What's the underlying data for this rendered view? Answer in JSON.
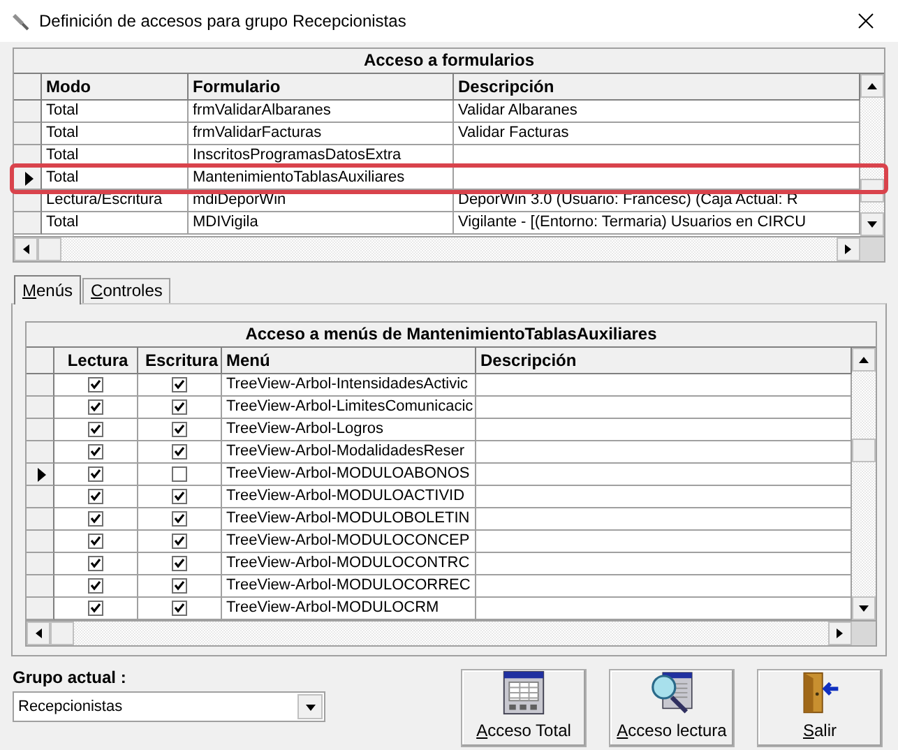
{
  "window": {
    "title": "Definición de accesos para grupo Recepcionistas"
  },
  "forms_grid": {
    "caption": "Acceso a formularios",
    "columns": [
      "Modo",
      "Formulario",
      "Descripción"
    ],
    "rows": [
      {
        "cells": [
          "Total",
          "frmValidarAlbaranes",
          "Validar Albaranes"
        ],
        "selected": false,
        "highlighted": false
      },
      {
        "cells": [
          "Total",
          "frmValidarFacturas",
          "Validar Facturas"
        ],
        "selected": false,
        "highlighted": false
      },
      {
        "cells": [
          "Total",
          "InscritosProgramasDatosExtra",
          ""
        ],
        "selected": false,
        "highlighted": false
      },
      {
        "cells": [
          "Total",
          "MantenimientoTablasAuxiliares",
          ""
        ],
        "selected": true,
        "highlighted": true
      },
      {
        "cells": [
          "Lectura/Escritura",
          "mdiDeporWin",
          "DeporWin 3.0  (Usuario: Francesc)  (Caja Actual: R"
        ],
        "selected": false,
        "highlighted": false
      },
      {
        "cells": [
          "Total",
          "MDIVigila",
          "Vigilante - [(Entorno: Termaria) Usuarios en CIRCU"
        ],
        "selected": false,
        "highlighted": false
      }
    ]
  },
  "tabs": [
    {
      "label": "Menús",
      "selected": true
    },
    {
      "label": "Controles",
      "selected": false
    }
  ],
  "menus_grid": {
    "caption": "Acceso a menús de MantenimientoTablasAuxiliares",
    "columns": [
      "Lectura",
      "Escritura",
      "Menú",
      "Descripción"
    ],
    "rows": [
      {
        "lectura": true,
        "escritura": true,
        "menu": "TreeView-Arbol-IntensidadesActivic",
        "selected": false
      },
      {
        "lectura": true,
        "escritura": true,
        "menu": "TreeView-Arbol-LimitesComunicacic",
        "selected": false
      },
      {
        "lectura": true,
        "escritura": true,
        "menu": "TreeView-Arbol-Logros",
        "selected": false
      },
      {
        "lectura": true,
        "escritura": true,
        "menu": "TreeView-Arbol-ModalidadesReser",
        "selected": false
      },
      {
        "lectura": true,
        "escritura": false,
        "menu": "TreeView-Arbol-MODULOABONOS",
        "selected": true
      },
      {
        "lectura": true,
        "escritura": true,
        "menu": "TreeView-Arbol-MODULOACTIVID",
        "selected": false
      },
      {
        "lectura": true,
        "escritura": true,
        "menu": "TreeView-Arbol-MODULOBOLETIN",
        "selected": false
      },
      {
        "lectura": true,
        "escritura": true,
        "menu": "TreeView-Arbol-MODULOCONCEP",
        "selected": false
      },
      {
        "lectura": true,
        "escritura": true,
        "menu": "TreeView-Arbol-MODULOCONTRC",
        "selected": false
      },
      {
        "lectura": true,
        "escritura": true,
        "menu": "TreeView-Arbol-MODULOCORREC",
        "selected": false
      },
      {
        "lectura": true,
        "escritura": true,
        "menu": "TreeView-Arbol-MODULOCRM",
        "selected": false
      }
    ]
  },
  "current_group": {
    "label": "Grupo actual :",
    "value": "Recepcionistas"
  },
  "buttons": [
    {
      "label": "Acceso Total",
      "kind": "table"
    },
    {
      "label": "Acceso lectura",
      "kind": "search"
    },
    {
      "label": "Salir",
      "kind": "exit"
    }
  ]
}
